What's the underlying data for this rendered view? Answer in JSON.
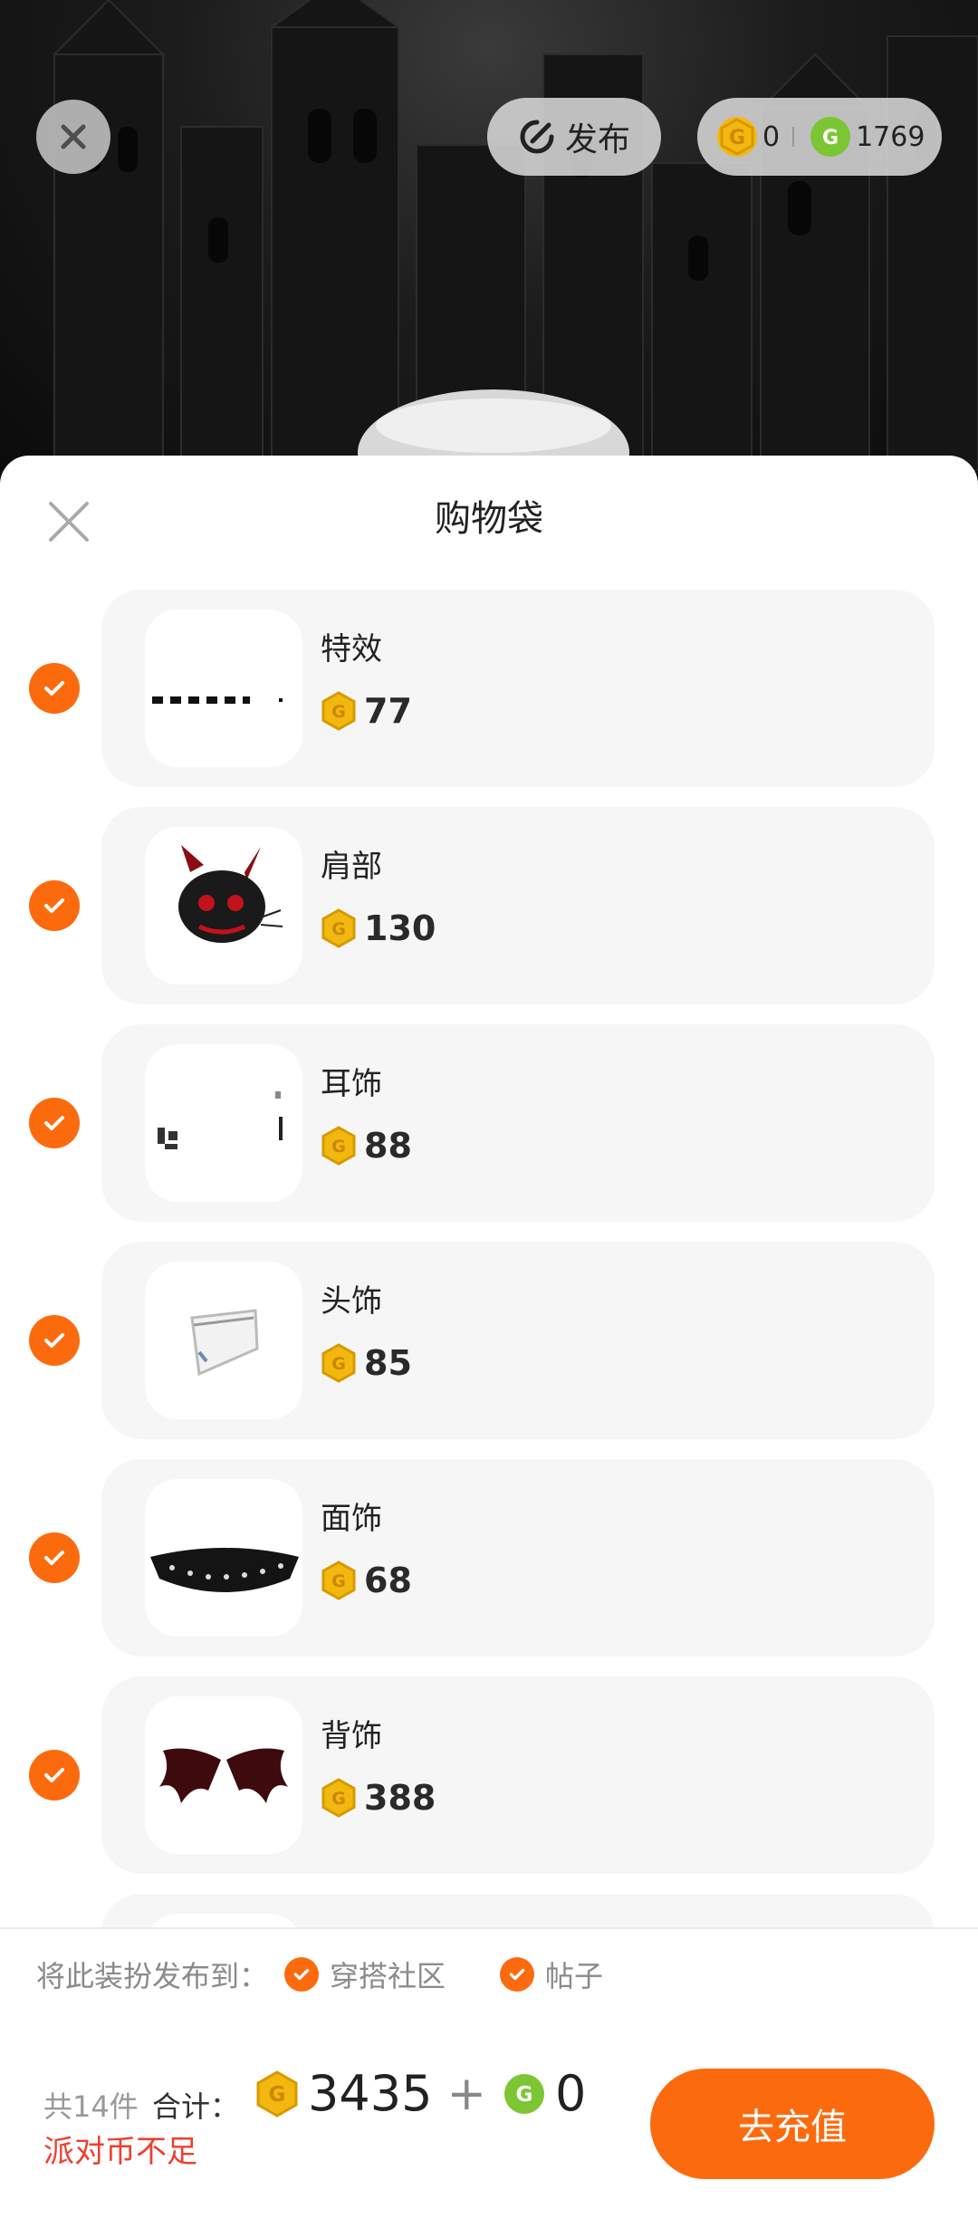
{
  "topbar": {
    "publish_label": "发布",
    "gold_balance": "0",
    "green_balance": "1769"
  },
  "sheet": {
    "title": "购物袋"
  },
  "items": [
    {
      "category": "特效",
      "price": "77",
      "thumb": "effect-dots"
    },
    {
      "category": "肩部",
      "price": "130",
      "thumb": "devil-cat"
    },
    {
      "category": "耳饰",
      "price": "88",
      "thumb": "earrings"
    },
    {
      "category": "头饰",
      "price": "85",
      "thumb": "headband"
    },
    {
      "category": "面饰",
      "price": "68",
      "thumb": "lace-mask"
    },
    {
      "category": "背饰",
      "price": "388",
      "thumb": "bat-wings"
    }
  ],
  "publish": {
    "label": "将此装扮发布到：",
    "option1": "穿搭社区",
    "option2": "帖子"
  },
  "footer": {
    "count": "共14件",
    "total_label": "合计：",
    "gold_total": "3435",
    "plus": "+",
    "green_total": "0",
    "warning": "派对币不足",
    "recharge_label": "去充值"
  },
  "colors": {
    "accent": "#fb6b0e",
    "gold_coin": "#f3b80f",
    "green_coin": "#7cc634",
    "warning": "#ee3f2e"
  }
}
